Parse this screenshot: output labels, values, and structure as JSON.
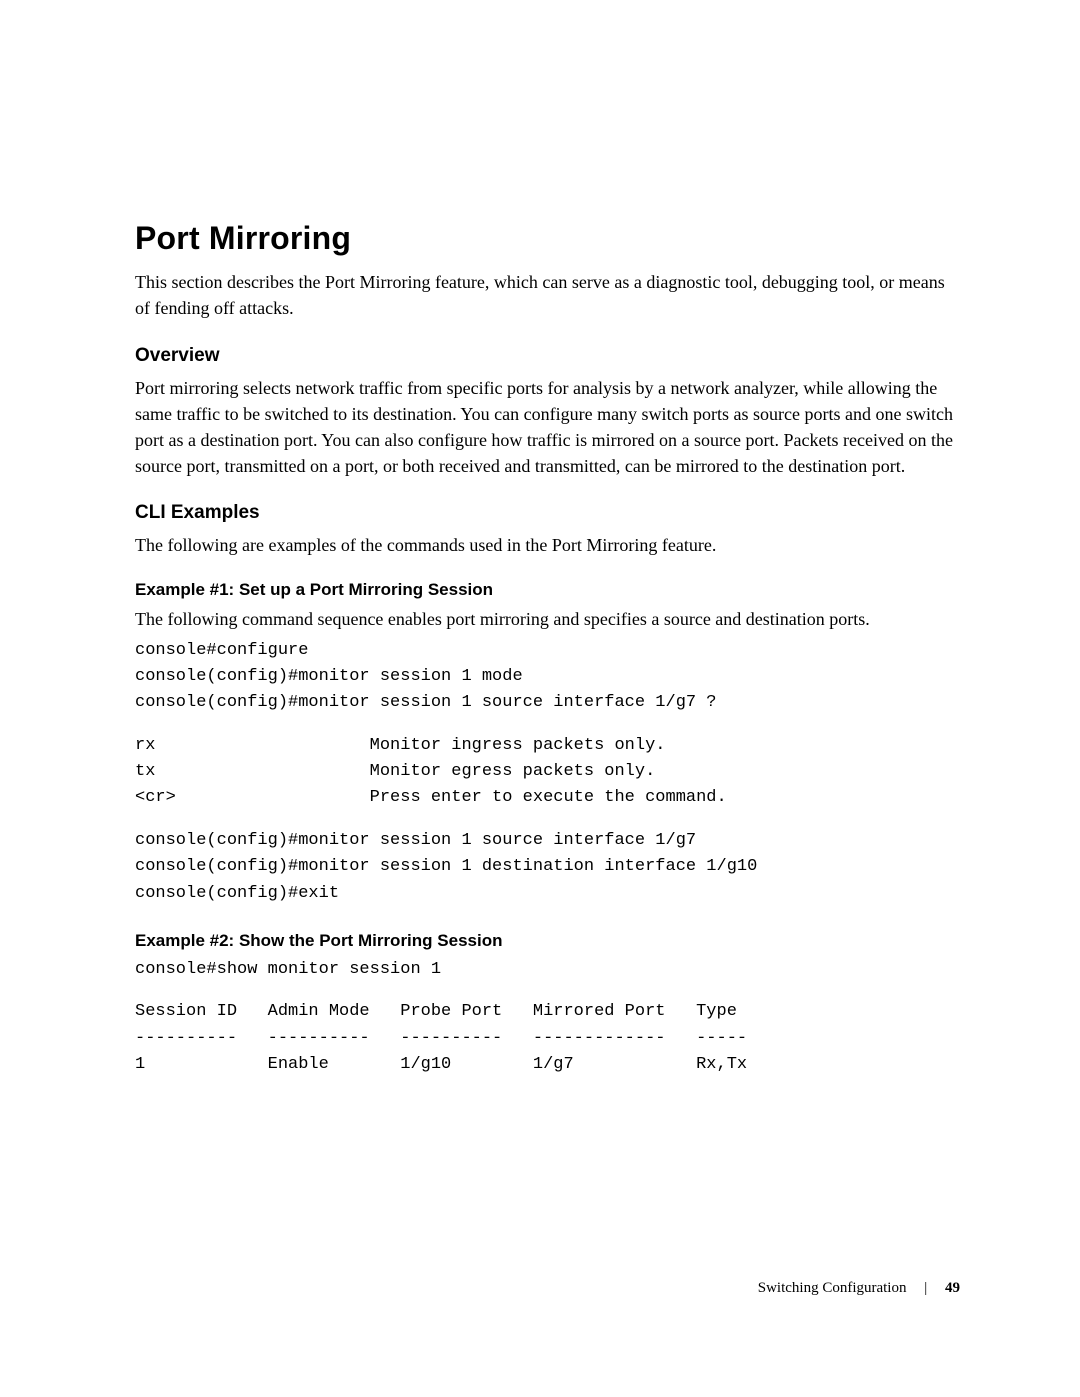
{
  "title": "Port Mirroring",
  "intro": "This section describes the Port Mirroring feature, which can serve as a diagnostic tool, debugging tool, or means of fending off attacks.",
  "overview": {
    "heading": "Overview",
    "text": "Port mirroring selects network traffic from specific ports for analysis by a network analyzer, while allowing the same traffic to be switched to its destination. You can configure many switch ports as source ports and one switch port as a destination port. You can also configure how traffic is mirrored on a source port. Packets received on the source port, transmitted on a port, or both received and transmitted, can be mirrored to the destination port."
  },
  "cli": {
    "heading": "CLI Examples",
    "lead": "The following are examples of the commands used in the Port Mirroring feature."
  },
  "ex1": {
    "heading": "Example #1: Set up a Port Mirroring Session",
    "lead": "The following command sequence enables port mirroring and specifies a source and destination ports.",
    "block1": "console#configure\nconsole(config)#monitor session 1 mode\nconsole(config)#monitor session 1 source interface 1/g7 ?",
    "block2": "rx                     Monitor ingress packets only.\ntx                     Monitor egress packets only.\n<cr>                   Press enter to execute the command.",
    "block3": "console(config)#monitor session 1 source interface 1/g7\nconsole(config)#monitor session 1 destination interface 1/g10\nconsole(config)#exit"
  },
  "ex2": {
    "heading": "Example #2: Show the Port Mirroring Session",
    "cmd": "console#show monitor session 1",
    "table": "Session ID   Admin Mode   Probe Port   Mirrored Port   Type\n----------   ----------   ----------   -------------   -----\n1            Enable       1/g10        1/g7            Rx,Tx"
  },
  "footer": {
    "section": "Switching Configuration",
    "page": "49"
  }
}
